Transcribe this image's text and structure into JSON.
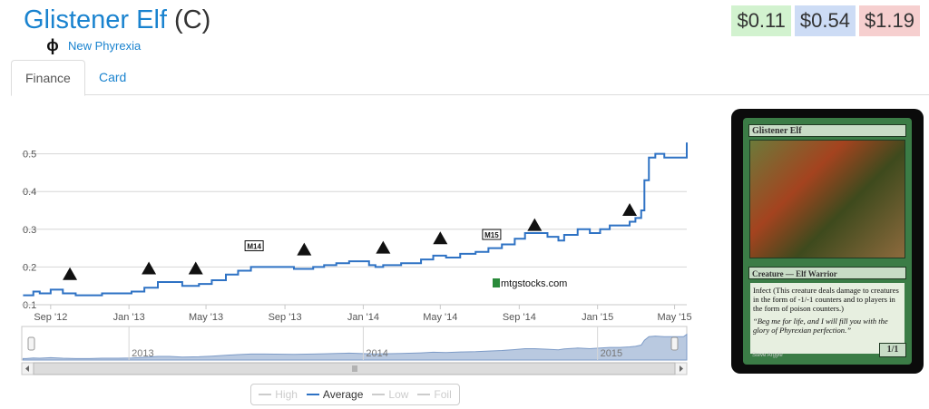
{
  "header": {
    "card_name": "Glistener Elf",
    "rarity": "(C)",
    "set_icon": "ϕ",
    "set_name": "New Phyrexia"
  },
  "prices": {
    "low": "$0.11",
    "average": "$0.54",
    "high": "$1.19"
  },
  "tabs": [
    {
      "label": "Finance",
      "active": true
    },
    {
      "label": "Card",
      "active": false
    }
  ],
  "watermark": "mtgstocks.com",
  "chart_data": {
    "type": "line",
    "x": [
      "2012-07-20",
      "2012-07-25",
      "2012-08-05",
      "2012-08-15",
      "2012-09-01",
      "2012-09-20",
      "2012-10-10",
      "2012-11-01",
      "2012-11-20",
      "2012-12-15",
      "2013-01-05",
      "2013-01-25",
      "2013-02-15",
      "2013-03-05",
      "2013-03-25",
      "2013-04-20",
      "2013-05-10",
      "2013-06-01",
      "2013-06-20",
      "2013-07-10",
      "2013-08-01",
      "2013-09-15",
      "2013-10-15",
      "2013-11-01",
      "2013-11-20",
      "2013-12-10",
      "2014-01-10",
      "2014-01-20",
      "2014-02-01",
      "2014-03-01",
      "2014-04-01",
      "2014-04-20",
      "2014-05-10",
      "2014-06-01",
      "2014-06-25",
      "2014-07-15",
      "2014-08-05",
      "2014-08-25",
      "2014-09-10",
      "2014-09-25",
      "2014-10-15",
      "2014-11-01",
      "2014-11-10",
      "2014-12-01",
      "2014-12-20",
      "2015-01-05",
      "2015-01-20",
      "2015-02-05",
      "2015-02-20",
      "2015-03-01",
      "2015-03-10",
      "2015-03-15",
      "2015-03-22",
      "2015-04-01",
      "2015-04-15",
      "2015-05-01",
      "2015-05-15",
      "2015-05-20"
    ],
    "series": [
      {
        "name": "Average",
        "values": [
          0.125,
          0.125,
          0.135,
          0.13,
          0.14,
          0.13,
          0.125,
          0.125,
          0.13,
          0.13,
          0.135,
          0.145,
          0.16,
          0.16,
          0.15,
          0.155,
          0.165,
          0.18,
          0.19,
          0.2,
          0.2,
          0.195,
          0.2,
          0.205,
          0.21,
          0.215,
          0.205,
          0.2,
          0.205,
          0.21,
          0.22,
          0.23,
          0.225,
          0.235,
          0.24,
          0.25,
          0.26,
          0.275,
          0.29,
          0.29,
          0.28,
          0.27,
          0.285,
          0.3,
          0.29,
          0.3,
          0.31,
          0.31,
          0.32,
          0.33,
          0.35,
          0.43,
          0.49,
          0.5,
          0.49,
          0.49,
          0.49,
          0.53
        ]
      }
    ],
    "y_ticks": [
      0.1,
      0.2,
      0.3,
      0.4,
      0.5
    ],
    "ylim": [
      0.1,
      0.6
    ],
    "x_ticks": [
      {
        "label": "Sep '12",
        "date": "2012-09-01"
      },
      {
        "label": "Jan '13",
        "date": "2013-01-01"
      },
      {
        "label": "May '13",
        "date": "2013-05-01"
      },
      {
        "label": "Sep '13",
        "date": "2013-09-01"
      },
      {
        "label": "Jan '14",
        "date": "2014-01-01"
      },
      {
        "label": "May '14",
        "date": "2014-05-01"
      },
      {
        "label": "Sep '14",
        "date": "2014-09-01"
      },
      {
        "label": "Jan '15",
        "date": "2015-01-01"
      },
      {
        "label": "May '15",
        "date": "2015-05-01"
      }
    ],
    "xlim": [
      "2012-07-18",
      "2015-05-20"
    ],
    "set_markers": [
      {
        "date": "2012-10-01",
        "value": 0.18
      },
      {
        "date": "2013-02-01",
        "value": 0.195
      },
      {
        "date": "2013-04-15",
        "value": 0.195
      },
      {
        "date": "2013-07-15",
        "value": 0.255,
        "label": "M14"
      },
      {
        "date": "2013-10-01",
        "value": 0.245
      },
      {
        "date": "2014-02-01",
        "value": 0.25
      },
      {
        "date": "2014-05-01",
        "value": 0.275
      },
      {
        "date": "2014-07-20",
        "value": 0.285,
        "label": "M15"
      },
      {
        "date": "2014-09-25",
        "value": 0.31
      },
      {
        "date": "2015-02-20",
        "value": 0.35
      }
    ],
    "navigator_labels": [
      "2013",
      "2014",
      "2015"
    ],
    "legend": [
      "High",
      "Average",
      "Low",
      "Foil"
    ],
    "legend_active": "Average",
    "line_color": "#2e72c4",
    "grid": true
  },
  "card": {
    "name": "Glistener Elf",
    "type_line": "Creature — Elf Warrior",
    "rules_text": "Infect (This creature deals damage to creatures in the form of -1/-1 counters and to players in the form of poison counters.)",
    "flavor_text": "“Beg me for life, and I will fill you with the glory of Phyrexian perfection.”",
    "pt": "1/1",
    "artist": "Steve Argyle"
  }
}
